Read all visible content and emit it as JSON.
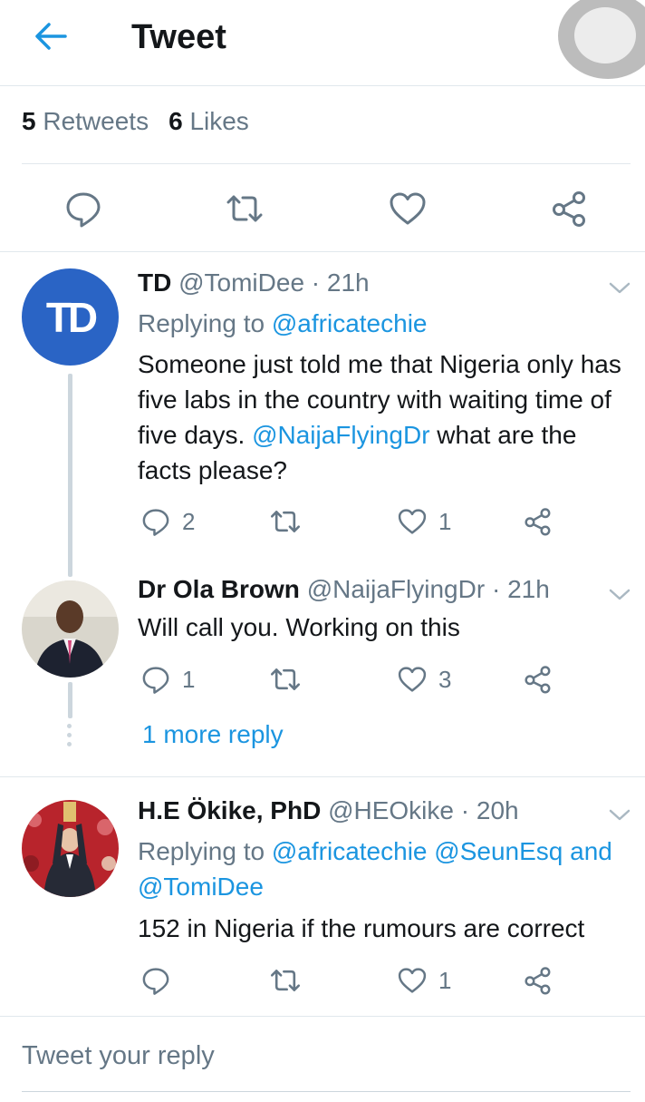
{
  "header": {
    "title": "Tweet"
  },
  "stats": {
    "retweets_count": "5",
    "retweets_label": "Retweets",
    "likes_count": "6",
    "likes_label": "Likes"
  },
  "tweets": [
    {
      "avatar_initials": "TD",
      "name": "TD",
      "handle": "@TomiDee",
      "time": "21h",
      "replying_prefix": "Replying to",
      "replying_to": [
        "@africatechie"
      ],
      "body_before": "Someone just told me that Nigeria only has five labs in the country with waiting time of five days. ",
      "body_mention": "@NaijaFlyingDr",
      "body_after": " what are the facts please?",
      "replies": "2",
      "likes": "1"
    },
    {
      "name": "Dr Ola Brown",
      "handle": "@NaijaFlyingDr",
      "time": "21h",
      "body": "Will call you. Working on this",
      "replies": "1",
      "likes": "3"
    },
    {
      "name": "H.E Ökike, PhD",
      "handle": "@HEOkike",
      "time": "20h",
      "replying_prefix": "Replying to",
      "replying_to": [
        "@africatechie",
        "@SeunEsq",
        "@TomiDee"
      ],
      "replying_and": "and",
      "body": "152 in Nigeria if the rumours are correct",
      "likes": "1"
    }
  ],
  "more_replies": "1 more reply",
  "reply_box": {
    "placeholder": "Tweet your reply"
  },
  "colors": {
    "accent": "#1b95e0",
    "muted": "#657786",
    "divider": "#e1e8ed"
  }
}
